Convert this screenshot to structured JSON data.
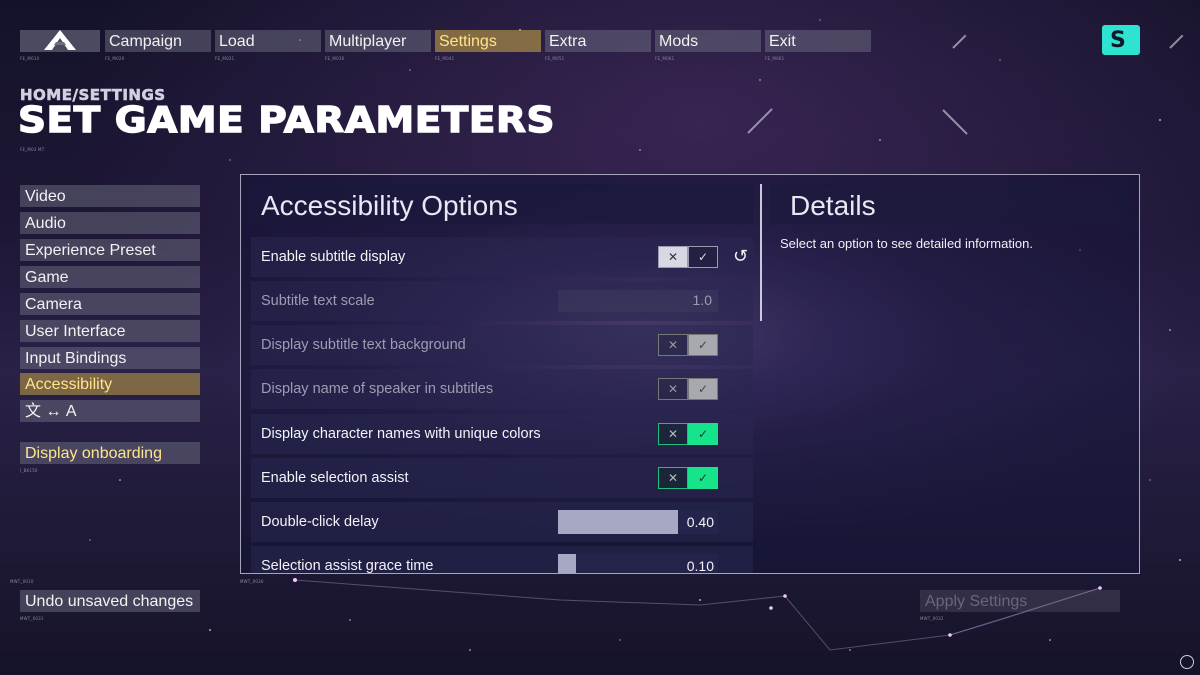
{
  "nav": {
    "items": [
      {
        "label": "Campaign",
        "code": "FE_M020"
      },
      {
        "label": "Load",
        "code": "FE_M021"
      },
      {
        "label": "Multiplayer",
        "code": "FE_M030"
      },
      {
        "label": "Settings",
        "code": "FE_M041",
        "active": true
      },
      {
        "label": "Extra",
        "code": "FE_M051"
      },
      {
        "label": "Mods",
        "code": "FE_M061"
      },
      {
        "label": "Exit",
        "code": "FE_M061"
      }
    ],
    "logo_code": "FE_M010",
    "brand_logo_glyph": "S"
  },
  "header": {
    "breadcrumb": "HOME/SETTINGS",
    "title": "SET GAME PARAMETERS",
    "title_code": "FE_M03 MT"
  },
  "sidebar": {
    "items": [
      {
        "label": "Video"
      },
      {
        "label": "Audio"
      },
      {
        "label": "Experience Preset"
      },
      {
        "label": "Game"
      },
      {
        "label": "Camera"
      },
      {
        "label": "User Interface"
      },
      {
        "label": "Input Bindings"
      },
      {
        "label": "Accessibility",
        "active": true
      },
      {
        "label": "文 ↔ A"
      }
    ],
    "onboarding_label": "Display onboarding",
    "onboarding_code": "I_BK150"
  },
  "accessibility": {
    "heading": "Accessibility Options",
    "rows": [
      {
        "label": "Enable subtitle display",
        "type": "toggle",
        "state": "off"
      },
      {
        "label": "Subtitle text scale",
        "type": "value",
        "value": "1.0"
      },
      {
        "label": "Display subtitle text background",
        "type": "toggle",
        "state": "on"
      },
      {
        "label": "Display name of speaker in subtitles",
        "type": "toggle",
        "state": "on"
      },
      {
        "label": "Display character names with unique colors",
        "type": "toggle",
        "state": "on"
      },
      {
        "label": "Enable selection assist",
        "type": "toggle",
        "state": "on"
      },
      {
        "label": "Double-click delay",
        "type": "slider",
        "value": "0.40",
        "fraction": 0.75
      },
      {
        "label": "Selection assist grace time",
        "type": "slider",
        "value": "0.10",
        "fraction": 0.11
      }
    ],
    "toggle_x_glyph": "✕",
    "toggle_check_glyph": "✓",
    "reset_glyph": "↺"
  },
  "details": {
    "heading": "Details",
    "text": "Select an option to see detailed information."
  },
  "footer": {
    "undo_label": "Undo unsaved changes",
    "undo_code": "MWT_0031",
    "apply_label": "Apply Settings",
    "apply_code": "MWT_0032",
    "panel_code": "MWT_0030",
    "sidebar_code": "MWT_0010"
  },
  "colors": {
    "accent_gold": "#ffe58a",
    "toggle_green": "#16e38a",
    "brand_teal": "#2fe3d3"
  }
}
